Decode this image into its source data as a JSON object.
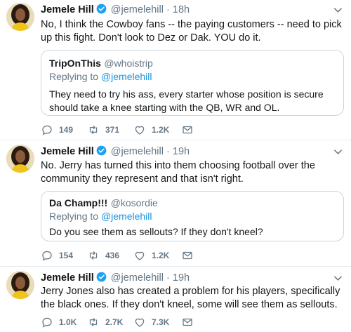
{
  "colors": {
    "text": "#14171a",
    "muted": "#657786",
    "link": "#1b95e0",
    "verified": "#1da1f2",
    "border": "#e6ecf0"
  },
  "tweets": [
    {
      "author": {
        "name": "Jemele Hill",
        "handle": "@jemelehill",
        "verified": true
      },
      "time": "18h",
      "text": "No, I think the Cowboy fans -- the paying customers -- need to pick up this fight. Don't look to Dez or Dak. YOU do it.",
      "quote": {
        "name": "TripOnThis",
        "handle": "@whoistrip",
        "replying_prefix": "Replying to",
        "replying_to": "@jemelehill",
        "text": "They need to try his ass, every starter whose position is secure should take a knee starting with the QB, WR and OL."
      },
      "stats": {
        "replies": "149",
        "retweets": "371",
        "likes": "1.2K"
      }
    },
    {
      "author": {
        "name": "Jemele Hill",
        "handle": "@jemelehill",
        "verified": true
      },
      "time": "19h",
      "text": "No. Jerry has turned this into them choosing football over the community they represent and that isn't right.",
      "quote": {
        "name": "Da Champ!!!",
        "handle": "@kosordie",
        "replying_prefix": "Replying to",
        "replying_to": "@jemelehill",
        "text": "Do you see them as sellouts? If they don't kneel?"
      },
      "stats": {
        "replies": "154",
        "retweets": "436",
        "likes": "1.2K"
      }
    },
    {
      "author": {
        "name": "Jemele Hill",
        "handle": "@jemelehill",
        "verified": true
      },
      "time": "19h",
      "text": "Jerry Jones also has created a problem for his players, specifically the black ones. If they don't kneel, some will see them as sellouts.",
      "stats": {
        "replies": "1.0K",
        "retweets": "2.7K",
        "likes": "7.3K"
      }
    }
  ]
}
